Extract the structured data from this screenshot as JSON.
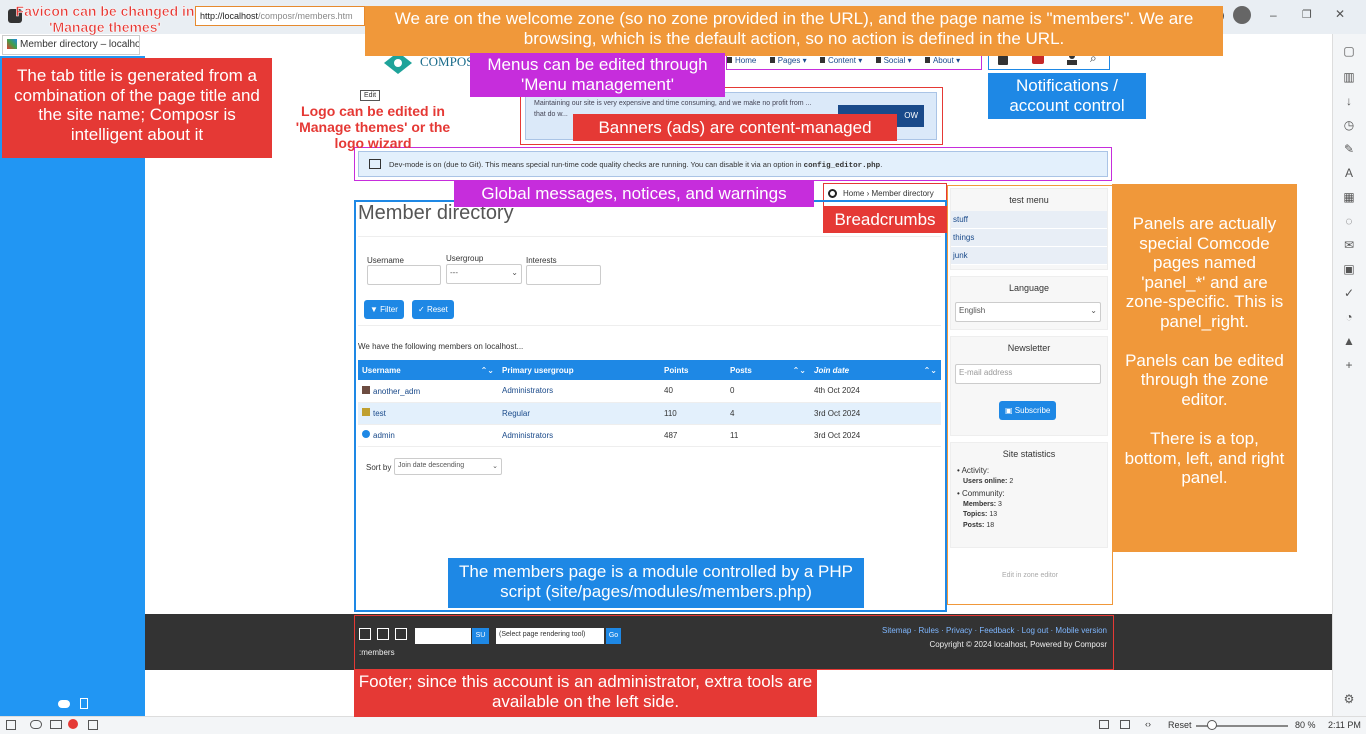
{
  "browser": {
    "tab_title": "Member directory – localhost",
    "url_host": "http://localhost",
    "url_path": "/composr/members.htm"
  },
  "site": {
    "logo_text": "COMPOS",
    "edit_label": "Edit",
    "menu": [
      "Home",
      "Pages ▾",
      "Content ▾",
      "Social ▾",
      "About ▾"
    ],
    "banner_text": "Maintaining our site is very expensive and time consuming, and we make no profit from ... that do w...",
    "banner_button": "OW",
    "dev_notice": "Dev-mode is on (due to Git). This means special run-time code quality checks are running. You can disable it via an option in ",
    "dev_notice_code": "config_editor.php",
    "dev_notice_end": ".",
    "breadcrumb_home": "Home",
    "breadcrumb_sep": "›",
    "breadcrumb_current": "Member directory"
  },
  "main": {
    "page_title": "Member directory",
    "filter": {
      "username_label": "Username",
      "usergroup_label": "Usergroup",
      "usergroup_value": "---",
      "interests_label": "Interests",
      "filter_button": "Filter",
      "reset_button": "Reset"
    },
    "intro": "We have the following members on localhost...",
    "columns": [
      "Username",
      "Primary usergroup",
      "Points",
      "Posts",
      "Join date"
    ],
    "rows": [
      {
        "username": "another_adm",
        "group": "Administrators",
        "points": "40",
        "posts": "0",
        "join": "4th Oct 2024"
      },
      {
        "username": "test",
        "group": "Regular",
        "points": "110",
        "posts": "4",
        "join": "3rd Oct 2024"
      },
      {
        "username": "admin",
        "group": "Administrators",
        "points": "487",
        "posts": "11",
        "join": "3rd Oct 2024"
      }
    ],
    "sort_label": "Sort by",
    "sort_value": "Join date descending"
  },
  "panel_right": {
    "menu_title": "test menu",
    "menu_items": [
      "stuff",
      "things",
      "junk"
    ],
    "language_title": "Language",
    "language_value": "English",
    "newsletter_title": "Newsletter",
    "email_placeholder": "E-mail address",
    "subscribe_button": "Subscribe",
    "stats_title": "Site statistics",
    "activity_label": "Activity:",
    "users_online_label": "Users online:",
    "users_online": "2",
    "community_label": "Community:",
    "members_label": "Members:",
    "members": "3",
    "topics_label": "Topics:",
    "topics": "13",
    "posts_label": "Posts:",
    "posts": "18",
    "edit_zone": "Edit in zone editor"
  },
  "footer": {
    "su_button": "SU",
    "render_tool": "(Select page rendering tool)",
    "go_button": "Go",
    "page_code": ":members",
    "links": "Sitemap · Rules · Privacy · Feedback · Log out · Mobile version",
    "copyright": "Copyright © 2024 localhost, Powered by Composr"
  },
  "annotations": {
    "favicon": "Favicon can be changed in 'Manage themes'",
    "url": "We are on the welcome zone (so no zone provided in the URL), and the page name is \"members\". We are browsing, which is the default action, so no action is defined in the URL.",
    "tab_title": "The tab title is generated from a combination of the page title and the site name; Composr is intelligent about it",
    "logo": "Logo can be edited in 'Manage themes' or the logo wizard",
    "menus": "Menus can be edited through 'Menu management'",
    "notifications": "Notifications / account control",
    "banners": "Banners (ads) are content-managed",
    "global_messages": "Global messages, notices, and warnings",
    "breadcrumbs": "Breadcrumbs",
    "panels": "Panels are actually special Comcode pages named 'panel_*' and are zone-specific. This is panel_right.\n\nPanels can be edited through the zone editor.\n\nThere is a top, bottom, left, and right panel.",
    "module": "The members page is a module controlled by a PHP script (site/pages/modules/members.php)",
    "footer": "Footer; since this account is an administrator, extra tools are available on the left side."
  },
  "status": {
    "reset": "Reset",
    "zoom": "80 %",
    "time": "2:11 PM"
  },
  "colors": {
    "accent_blue": "#1e88e5",
    "note_red": "#e53935",
    "note_orange": "#f0983a",
    "note_magenta": "#c62ddc"
  }
}
